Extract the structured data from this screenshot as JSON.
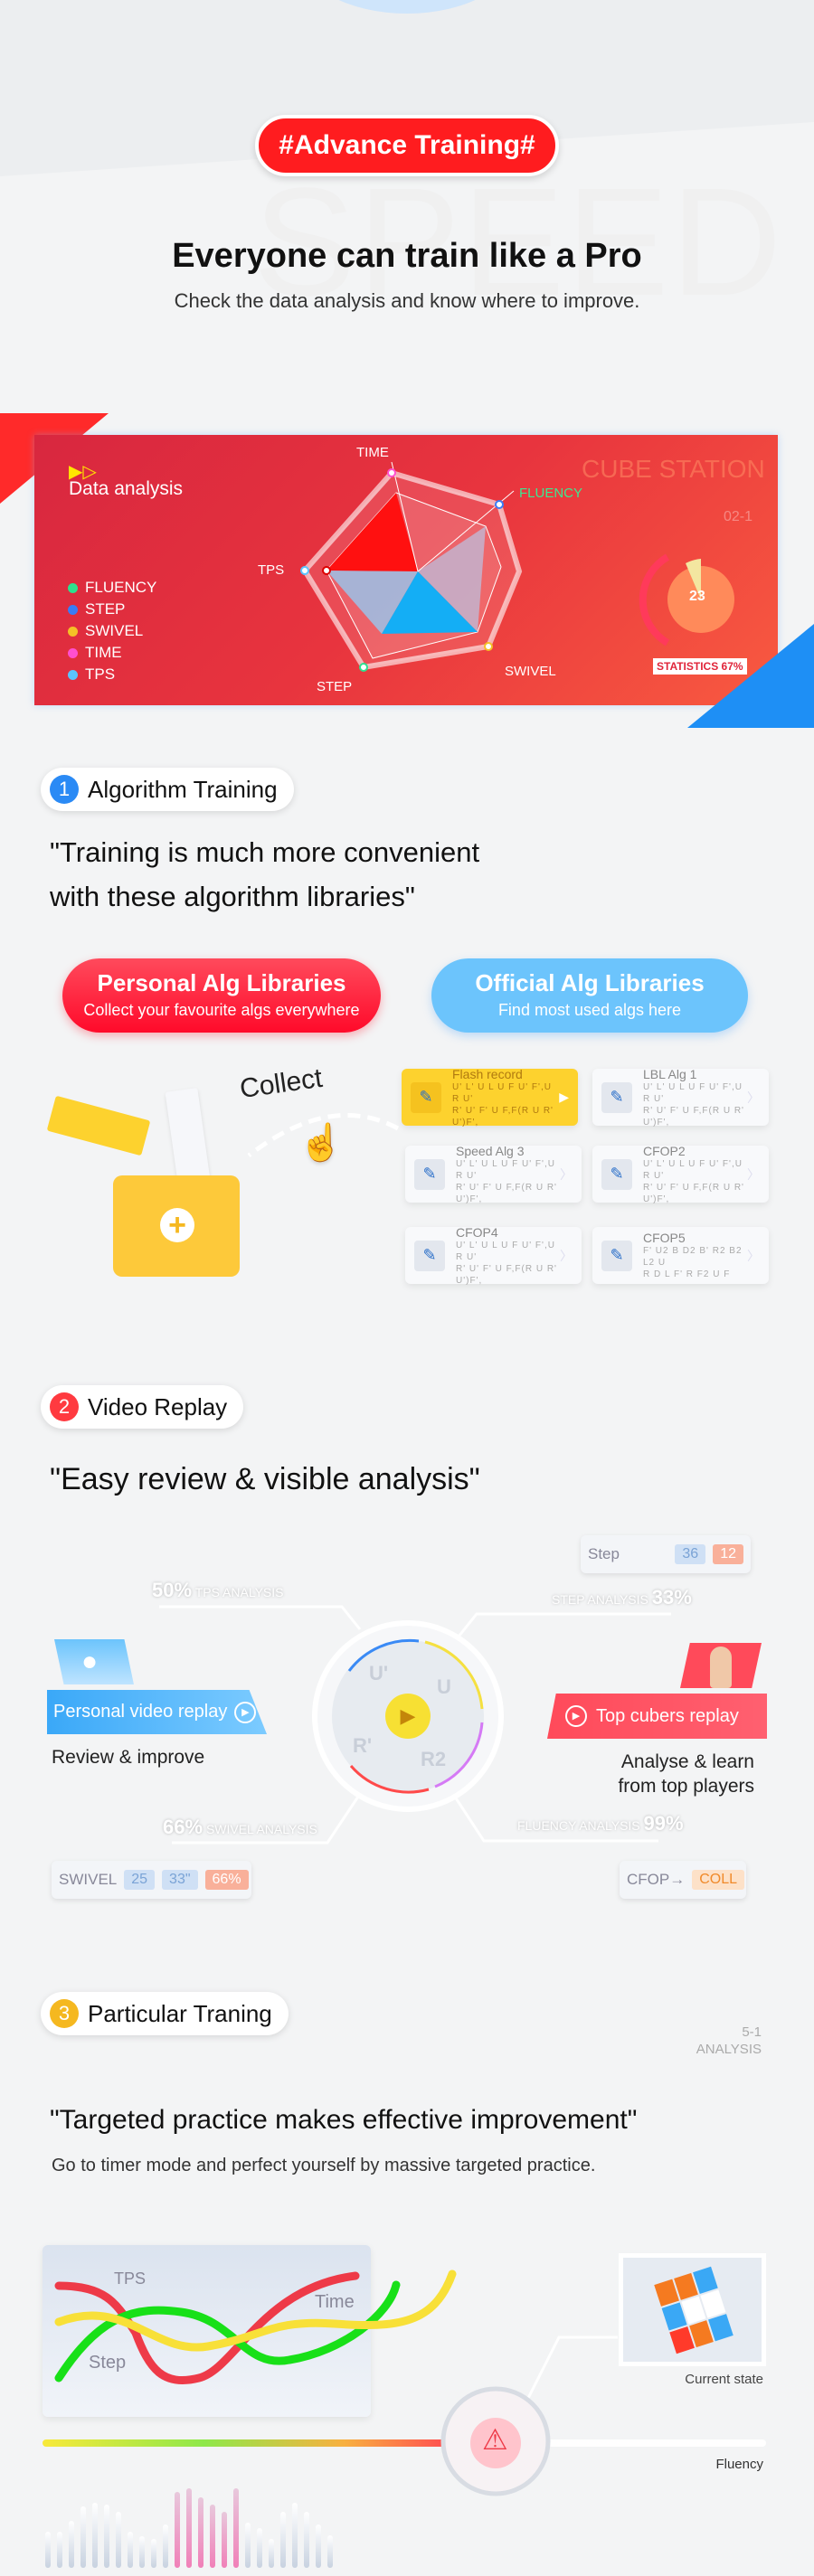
{
  "header": {
    "tag": "#Advance Training#",
    "watermark": "SPEED",
    "title": "Everyone can train like a Pro",
    "subtitle": "Check the data analysis and know where to improve."
  },
  "data_card": {
    "title": "Data analysis",
    "brand": "CUBE STATION",
    "code": "02-1",
    "donut_value": "23",
    "statistics": "STATISTICS 67%",
    "axes": [
      "TIME",
      "FLUENCY",
      "SWIVEL",
      "STEP",
      "TPS"
    ],
    "legend": [
      {
        "label": "FLUENCY",
        "color": "#2ee08e"
      },
      {
        "label": "STEP",
        "color": "#3a7cf5"
      },
      {
        "label": "SWIVEL",
        "color": "#f5c026"
      },
      {
        "label": "TIME",
        "color": "#ff4fd0"
      },
      {
        "label": "TPS",
        "color": "#5bc4ff"
      }
    ]
  },
  "section1": {
    "number": "1",
    "title": "Algorithm Training",
    "quote_line1": "\"Training is much more convenient",
    "quote_line2": "with these algorithm libraries\"",
    "personal": {
      "title": "Personal Alg Libraries",
      "subtitle": "Collect your favourite algs everywhere"
    },
    "official": {
      "title": "Official Alg Libraries",
      "subtitle": "Find most used algs here"
    },
    "collect": "Collect",
    "algs": [
      {
        "name": "Flash record",
        "line1": "U' L' U L U F U' F',U R U'",
        "line2": "R' U' F' U F,F(R U R' U')F',"
      },
      {
        "name": "LBL Alg 1",
        "line1": "U' L' U L U F U' F',U R U'",
        "line2": "R' U' F' U F,F(R U R' U')F',"
      },
      {
        "name": "Speed Alg 3",
        "line1": "U' L' U L U F U' F',U R U'",
        "line2": "R' U' F' U F,F(R U R' U')F',"
      },
      {
        "name": "CFOP2",
        "line1": "U' L' U L U F U' F',U R U'",
        "line2": "R' U' F' U F,F(R U R' U')F',"
      },
      {
        "name": "CFOP4",
        "line1": "U' L' U L U F U' F',U R U'",
        "line2": "R' U' F' U F,F(R U R' U')F',"
      },
      {
        "name": "CFOP5",
        "line1": "F' U2 B D2 B' R2 B2 L2 U",
        "line2": "R D L F' R F2 U F"
      }
    ]
  },
  "section2": {
    "number": "2",
    "title": "Video Replay",
    "quote": "\"Easy review & visible analysis\"",
    "step_box": {
      "label": "Step",
      "v1": "36",
      "v2": "12"
    },
    "tps": {
      "pct": "50%",
      "label": "TPS ANALYSIS"
    },
    "step": {
      "label": "STEP ANALYSIS",
      "pct": "33%"
    },
    "swivel": {
      "pct": "66%",
      "label": "SWIVEL ANALYSIS"
    },
    "fluency": {
      "label": "FLUENCY ANALYSIS",
      "pct": "99%"
    },
    "moves": [
      "U'",
      "U",
      "R'",
      "R2"
    ],
    "personal_btn": "Personal video replay",
    "personal_caption": "Review & improve",
    "top_btn": "Top cubers replay",
    "top_caption_1": "Analyse & learn",
    "top_caption_2": "from top players",
    "swivel_box": {
      "label": "SWIVEL",
      "v1": "25",
      "v2": "33\"",
      "v3": "66%"
    },
    "cfop_box": {
      "label": "CFOP→",
      "v1": "COLL"
    }
  },
  "section3": {
    "number": "3",
    "title": "Particular Traning",
    "code": "5-1",
    "code_label": "ANALYSIS",
    "quote": "\"Targeted practice makes effective improvement\"",
    "subtitle": "Go to timer mode and perfect yourself by massive targeted practice.",
    "curves": {
      "tps": "TPS",
      "time": "Time",
      "step": "Step"
    },
    "current_state": "Current state",
    "fluency": "Fluency"
  }
}
